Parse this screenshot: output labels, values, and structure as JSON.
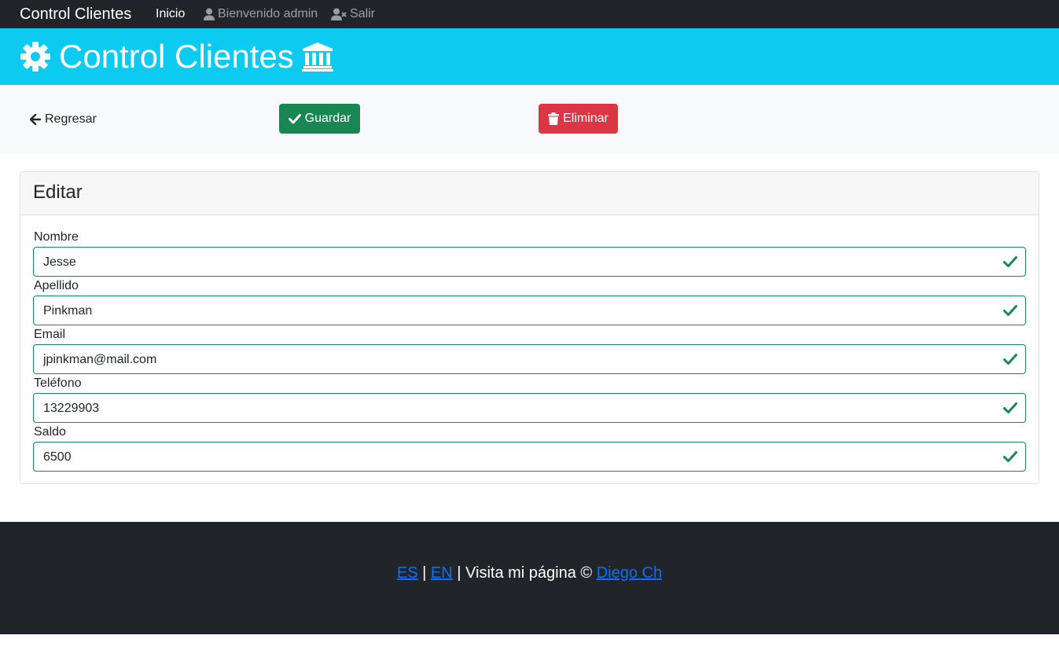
{
  "navbar": {
    "brand": "Control Clientes",
    "home": "Inicio",
    "welcome": "Bienvenido admin",
    "logout": "Salir"
  },
  "banner": {
    "title": "Control Clientes",
    "left_icon": "gear-icon",
    "right_icon": "bank-icon"
  },
  "actions": {
    "back_label": "Regresar",
    "save_label": "Guardar",
    "delete_label": "Eliminar"
  },
  "form": {
    "title": "Editar",
    "fields": [
      {
        "label": "Nombre",
        "value": "Jesse"
      },
      {
        "label": "Apellido",
        "value": "Pinkman"
      },
      {
        "label": "Email",
        "value": "jpinkman@mail.com"
      },
      {
        "label": "Teléfono",
        "value": "13229903"
      },
      {
        "label": "Saldo",
        "value": "6500"
      }
    ]
  },
  "footer": {
    "lang_es": "ES",
    "sep1": "|",
    "lang_en": "EN",
    "text": "| Visita mi página ©",
    "author": "Diego Ch"
  },
  "colors": {
    "navbar": "#212529",
    "banner": "#0dcaf0",
    "success": "#198754",
    "danger": "#dc3545",
    "link": "#0d6efd"
  }
}
